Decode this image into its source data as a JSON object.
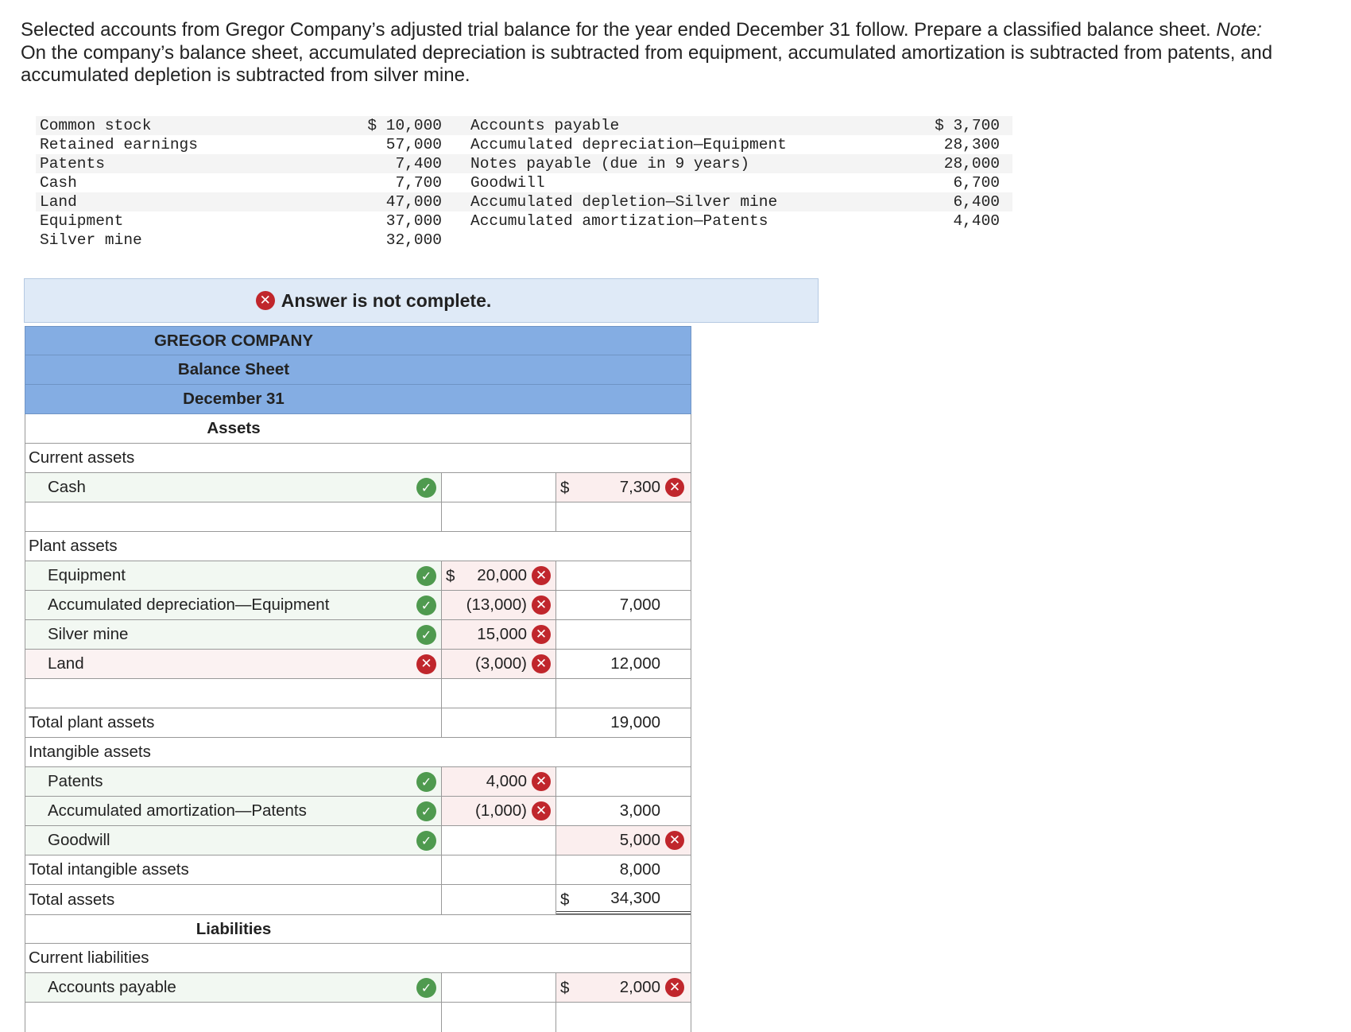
{
  "intro": {
    "text_before_note": "Selected accounts from Gregor Company’s adjusted trial balance for the year ended December 31 follow. Prepare a classified balance sheet. ",
    "note_label": "Note:",
    "text_after_note": " On the company’s balance sheet, accumulated depreciation is subtracted from equipment, accumulated amortization is subtracted from patents, and accumulated depletion is subtracted from silver mine."
  },
  "trial_balance": {
    "left": [
      {
        "account": "Common stock",
        "amount": "$ 10,000"
      },
      {
        "account": "Retained earnings",
        "amount": "57,000"
      },
      {
        "account": "Patents",
        "amount": "7,400"
      },
      {
        "account": "Cash",
        "amount": "7,700"
      },
      {
        "account": "Land",
        "amount": "47,000"
      },
      {
        "account": "Equipment",
        "amount": "37,000"
      },
      {
        "account": "Silver mine",
        "amount": "32,000"
      }
    ],
    "right": [
      {
        "account": "Accounts payable",
        "amount": "$ 3,700"
      },
      {
        "account": "Accumulated depreciation—Equipment",
        "amount": "28,300"
      },
      {
        "account": "Notes payable (due in 9 years)",
        "amount": "28,000"
      },
      {
        "account": "Goodwill",
        "amount": "6,700"
      },
      {
        "account": "Accumulated depletion—Silver mine",
        "amount": "6,400"
      },
      {
        "account": "Accumulated amortization—Patents",
        "amount": "4,400"
      }
    ]
  },
  "banner": {
    "label": "Answer is not complete.",
    "icon": "x-circle-icon"
  },
  "balance_sheet": {
    "company": "GREGOR COMPANY",
    "title": "Balance Sheet",
    "date": "December 31",
    "assets_heading": "Assets",
    "liabilities_heading": "Liabilities",
    "currency": "$",
    "rows": {
      "current_assets": "Current assets",
      "cash": {
        "label": "Cash",
        "total": "7,300"
      },
      "plant_assets": "Plant assets",
      "equipment": {
        "label": "Equipment",
        "amount": "20,000"
      },
      "accum_dep": {
        "label": "Accumulated depreciation—Equipment",
        "amount": "(13,000)",
        "total": "7,000"
      },
      "silver_mine": {
        "label": "Silver mine",
        "amount": "15,000"
      },
      "land": {
        "label": "Land",
        "amount": "(3,000)",
        "total": "12,000"
      },
      "total_plant": {
        "label": "Total plant assets",
        "total": "19,000"
      },
      "intangible": "Intangible assets",
      "patents": {
        "label": "Patents",
        "amount": "4,000"
      },
      "accum_amort": {
        "label": "Accumulated amortization—Patents",
        "amount": "(1,000)",
        "total": "3,000"
      },
      "goodwill": {
        "label": "Goodwill",
        "total": "5,000"
      },
      "total_intangible": {
        "label": "Total intangible assets",
        "total": "8,000"
      },
      "total_assets": {
        "label": "Total assets",
        "total": "34,300"
      },
      "current_liabilities": "Current liabilities",
      "accounts_payable": {
        "label": "Accounts payable",
        "total": "2,000"
      }
    }
  },
  "colors": {
    "header_blue": "#84ade3",
    "banner_bg": "#dfeaf7",
    "check_green": "#4f9a4f",
    "x_red": "#c0262c"
  }
}
